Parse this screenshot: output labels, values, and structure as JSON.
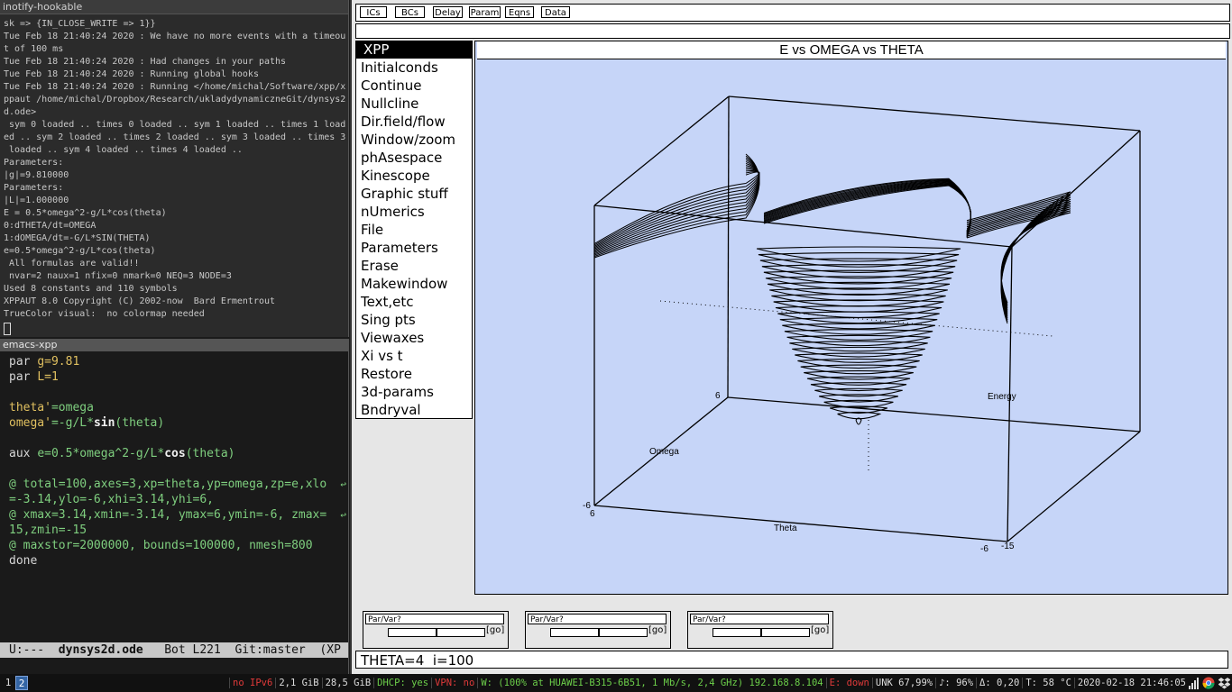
{
  "terminal": {
    "title": "inotify-hookable",
    "lines": [
      "sk => {IN_CLOSE_WRITE => 1}}",
      "Tue Feb 18 21:40:24 2020 : We have no more events with a timeou",
      "t of 100 ms",
      "Tue Feb 18 21:40:24 2020 : Had changes in your paths",
      "Tue Feb 18 21:40:24 2020 : Running global hooks",
      "Tue Feb 18 21:40:24 2020 : Running </home/michal/Software/xpp/x",
      "ppaut /home/michal/Dropbox/Research/ukladydynamiczneGit/dynsys2",
      "d.ode>",
      " sym 0 loaded .. times 0 loaded .. sym 1 loaded .. times 1 load",
      "ed .. sym 2 loaded .. times 2 loaded .. sym 3 loaded .. times 3",
      " loaded .. sym 4 loaded .. times 4 loaded ..",
      "Parameters:",
      "|g|=9.810000",
      "Parameters:",
      "|L|=1.000000",
      "E = 0.5*omega^2-g/L*cos(theta)",
      "0:dTHETA/dt=OMEGA",
      "1:dOMEGA/dt=-G/L*SIN(THETA)",
      "e=0.5*omega^2-g/L*cos(theta)",
      " All formulas are valid!!",
      " nvar=2 naux=1 nfix=0 nmark=0 NEQ=3 NODE=3",
      "Used 8 constants and 110 symbols",
      "XPPAUT 8.0 Copyright (C) 2002-now  Bard Ermentrout",
      "TrueColor visual:  no colormap needed"
    ]
  },
  "emacs": {
    "title": "emacs-xpp",
    "lines": [
      [
        {
          "t": "par ",
          "c": "n"
        },
        {
          "t": "g=9.81",
          "c": "y"
        }
      ],
      [
        {
          "t": "par ",
          "c": "n"
        },
        {
          "t": "L=1",
          "c": "y"
        }
      ],
      [],
      [
        {
          "t": "theta'",
          "c": "y"
        },
        {
          "t": "=omega",
          "c": "g"
        }
      ],
      [
        {
          "t": "omega'",
          "c": "y"
        },
        {
          "t": "=-g/L*",
          "c": "g"
        },
        {
          "t": "sin",
          "c": "w"
        },
        {
          "t": "(theta)",
          "c": "g"
        }
      ],
      [],
      [
        {
          "t": "aux ",
          "c": "n"
        },
        {
          "t": "e=0.5*omega^2-g/L*",
          "c": "g"
        },
        {
          "t": "cos",
          "c": "w"
        },
        {
          "t": "(theta)",
          "c": "g"
        }
      ],
      [],
      [
        {
          "t": "@ total=100,axes=3,xp=theta,yp=omega,zp=e,xlo",
          "c": "g"
        }
      ],
      [
        {
          "t": "=-3.14,ylo=-6,xhi=3.14,yhi=6,",
          "c": "g"
        }
      ],
      [
        {
          "t": "@ xmax=3.14,xmin=-3.14, ymax=6,ymin=-6, zmax=",
          "c": "g"
        }
      ],
      [
        {
          "t": "15,zmin=-15",
          "c": "g"
        }
      ],
      [
        {
          "t": "@ maxstor=2000000, bounds=100000, nmesh=800",
          "c": "g"
        }
      ],
      [
        {
          "t": "done",
          "c": "n"
        }
      ]
    ],
    "modeline": {
      "state": "U:---",
      "file": "dynsys2d.ode",
      "pos": "Bot L221",
      "vcs": "Git:master",
      "mode": "(XP"
    }
  },
  "xpp": {
    "top_buttons": [
      "ICs",
      "BCs",
      "Delay",
      "Param",
      "Eqns",
      "Data"
    ],
    "menu_title": "XPP",
    "menu_items": [
      "Initialconds",
      "Continue",
      "Nullcline",
      "Dir.field/flow",
      "Window/zoom",
      "phAsespace",
      "Kinescope",
      "Graphic stuff",
      "nUmerics",
      "File",
      "Parameters",
      "Erase",
      "Makewindow",
      "Text,etc",
      "Sing pts",
      "Viewaxes",
      "Xi vs t",
      "Restore",
      "3d-params",
      "Bndryval"
    ],
    "plot_title": "E vs OMEGA vs THETA",
    "axis_labels": {
      "x": "Theta",
      "y": "Omega",
      "z": "Energy"
    },
    "tick_labels": [
      "6",
      "-6",
      "6",
      "-6",
      "-15"
    ],
    "sliders": [
      {
        "label": "Par/Var?",
        "go": "go",
        "position": 0.5
      },
      {
        "label": "Par/Var?",
        "go": "go",
        "position": 0.5
      },
      {
        "label": "Par/Var?",
        "go": "go",
        "position": 0.5
      }
    ],
    "status": "THETA=4  i=100",
    "colors": {
      "plot_bg": "#c6d5f8",
      "menu_title_bg": "#000000"
    }
  },
  "sysbar": {
    "workspaces": [
      "1",
      "2"
    ],
    "active_workspace": "2",
    "blocks": [
      {
        "text": "no IPv6",
        "c": "red"
      },
      {
        "text": "2,1 GiB",
        "c": ""
      },
      {
        "text": "28,5 GiB",
        "c": ""
      },
      {
        "text": "DHCP: yes",
        "c": "green"
      },
      {
        "text": "VPN: no",
        "c": "red"
      },
      {
        "text": "W: (100% at HUAWEI-B315-6B51, 1 Mb/s, 2,4 GHz) 192.168.8.104",
        "c": "green"
      },
      {
        "text": "E: down",
        "c": "red"
      },
      {
        "text": "UNK 67,99%",
        "c": ""
      },
      {
        "text": "♪: 96%",
        "c": ""
      },
      {
        "text": "Δ: 0,20",
        "c": ""
      },
      {
        "text": "T: 58 °C",
        "c": ""
      },
      {
        "text": "2020-02-18 21:46:05",
        "c": ""
      }
    ],
    "tray_icons": [
      "wifi-icon",
      "chrome-icon",
      "dropbox-icon"
    ]
  }
}
